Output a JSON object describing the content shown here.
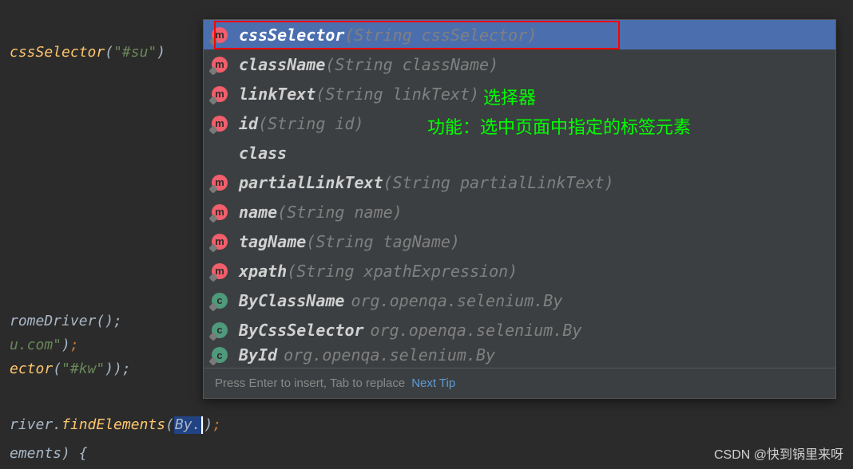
{
  "code": {
    "line1_method": "cssSelector",
    "line1_string": "\"#su\"",
    "line6_text": "romeDriver();",
    "line7_string": "u.com\"",
    "line8_method": "ector",
    "line8_string": "\"#kw\"",
    "line9_prefix": "river.",
    "line9_method": "findElements",
    "line9_obj": "By",
    "line10_text": "ements) {"
  },
  "completion": {
    "items": [
      {
        "icon": "m",
        "name": "cssSelector",
        "params": "(String cssSelector)",
        "selected": true
      },
      {
        "icon": "m",
        "name": "className",
        "params": "(String className)"
      },
      {
        "icon": "m",
        "name": "linkText",
        "params": "(String linkText)"
      },
      {
        "icon": "m",
        "name": "id",
        "params": "(String id)"
      },
      {
        "icon": "",
        "name": "class",
        "params": ""
      },
      {
        "icon": "m",
        "name": "partialLinkText",
        "params": "(String partialLinkText)"
      },
      {
        "icon": "m",
        "name": "name",
        "params": "(String name)"
      },
      {
        "icon": "m",
        "name": "tagName",
        "params": "(String tagName)"
      },
      {
        "icon": "m",
        "name": "xpath",
        "params": "(String xpathExpression)"
      },
      {
        "icon": "c",
        "name": "ByClassName",
        "pkg": "org.openqa.selenium.By"
      },
      {
        "icon": "c",
        "name": "ByCssSelector",
        "pkg": "org.openqa.selenium.By"
      },
      {
        "icon": "c",
        "name": "ById",
        "pkg": "org.openqa.selenium.By",
        "truncated": true
      }
    ],
    "footer_hint": "Press Enter to insert, Tab to replace",
    "footer_link": "Next Tip"
  },
  "annotations": {
    "label1": "选择器",
    "label2": "功能：选中页面中指定的标签元素"
  },
  "watermark": "CSDN @快到锅里来呀"
}
